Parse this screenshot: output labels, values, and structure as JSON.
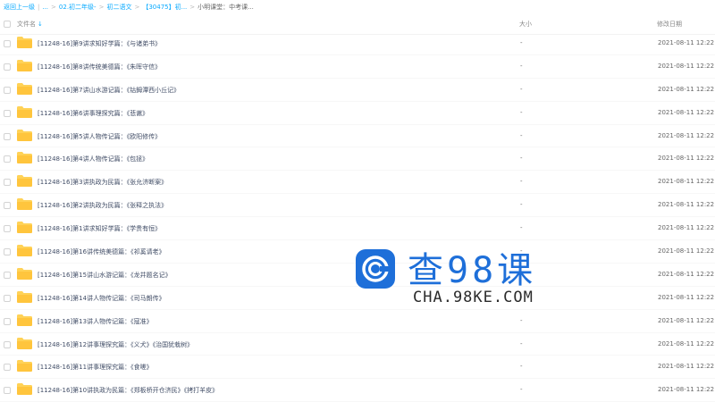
{
  "breadcrumb": {
    "items": [
      "返回上一级",
      "...",
      "02.初二年级-",
      "初二语文",
      "【30475】初...",
      "小明课堂：中考课..."
    ],
    "separators": [
      "|",
      ">",
      ">",
      ">",
      ">"
    ]
  },
  "header": {
    "name_label": "文件名",
    "size_label": "大小",
    "date_label": "修改日期",
    "sort_icon": "arrow-down-icon"
  },
  "colors": {
    "accent": "#09aaff",
    "folder": "#ffd257",
    "text": "#424e67",
    "watermark": "#1e6fd9"
  },
  "files": [
    {
      "name": "[11248-16]第9讲求知好学篇：《与诸弟书》",
      "size": "-",
      "date": "2021-08-11 12:22"
    },
    {
      "name": "[11248-16]第8讲传统美德篇：《朱晖守信》",
      "size": "-",
      "date": "2021-08-11 12:22"
    },
    {
      "name": "[11248-16]第7讲山水游记篇：《钴鉧潭西小丘记》",
      "size": "-",
      "date": "2021-08-11 12:22"
    },
    {
      "name": "[11248-16]第6讲事理探究篇：《悲谳》",
      "size": "-",
      "date": "2021-08-11 12:22"
    },
    {
      "name": "[11248-16]第5讲人物传记篇：《欧阳修传》",
      "size": "-",
      "date": "2021-08-11 12:22"
    },
    {
      "name": "[11248-16]第4讲人物传记篇：《包拯》",
      "size": "-",
      "date": "2021-08-11 12:22"
    },
    {
      "name": "[11248-16]第3讲执政为民篇：《张允济断案》",
      "size": "-",
      "date": "2021-08-11 12:22"
    },
    {
      "name": "[11248-16]第2讲执政为民篇：《张释之执法》",
      "size": "-",
      "date": "2021-08-11 12:22"
    },
    {
      "name": "[11248-16]第1讲求知好学篇：《学贵有恒》",
      "size": "-",
      "date": "2021-08-11 12:22"
    },
    {
      "name": "[11248-16]第16讲传统美德篇：《祁奚请老》",
      "size": "-",
      "date": "2021-08-11 12:22"
    },
    {
      "name": "[11248-16]第15讲山水游记篇：《龙井题名记》",
      "size": "-",
      "date": "2021-08-11 12:22"
    },
    {
      "name": "[11248-16]第14讲人物传记篇：《司马朗传》",
      "size": "-",
      "date": "2021-08-11 12:22"
    },
    {
      "name": "[11248-16]第13讲人物传记篇：《寇准》",
      "size": "-",
      "date": "2021-08-11 12:22"
    },
    {
      "name": "[11248-16]第12讲事理探究篇：《义犬》《治国犹栽树》",
      "size": "-",
      "date": "2021-08-11 12:22"
    },
    {
      "name": "[11248-16]第11讲事理探究篇：《食嗟》",
      "size": "-",
      "date": "2021-08-11 12:22"
    },
    {
      "name": "[11248-16]第10讲执政为民篇：《郑板桥开仓济民》《拷打羊皮》",
      "size": "-",
      "date": "2021-08-11 12:22"
    }
  ],
  "watermark": {
    "title": "查98课",
    "url": "CHA.98KE.COM",
    "icon": "c-logo-icon"
  }
}
